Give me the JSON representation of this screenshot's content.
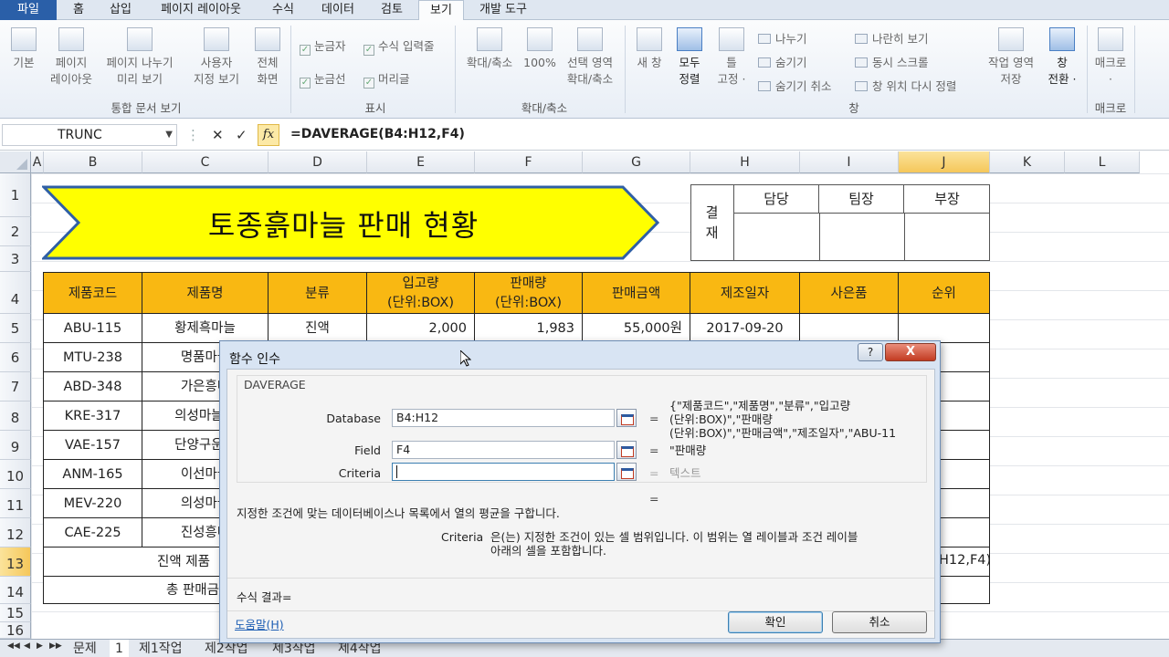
{
  "ribbon_tabs": [
    "파일",
    "홈",
    "삽입",
    "페이지 레이아웃",
    "수식",
    "데이터",
    "검토",
    "보기",
    "개발 도구"
  ],
  "ribbon": {
    "workbook_views": [
      "기본",
      "페이지 레이아웃",
      "페이지 나누기 미리 보기",
      "사용자 지정 보기",
      "전체 화면"
    ],
    "workbook_views_lines": [
      [
        "기본",
        ""
      ],
      [
        "페이지",
        "레이아웃"
      ],
      [
        "페이지 나누기",
        "미리 보기"
      ],
      [
        "사용자",
        "지정 보기"
      ],
      [
        "전체",
        "화면"
      ]
    ],
    "group_workbook_views": "통합 문서 보기",
    "show_items": [
      "눈금자",
      "수식 입력줄",
      "눈금선",
      "머리글"
    ],
    "group_show": "표시",
    "zoom_items": [
      [
        "확대/축소",
        ""
      ],
      [
        "100%",
        ""
      ],
      [
        "선택 영역",
        "확대/축소"
      ]
    ],
    "group_zoom": "확대/축소",
    "window_big": [
      [
        "새 창",
        ""
      ],
      [
        "모두",
        "정렬"
      ],
      [
        "틀",
        "고정 ·"
      ]
    ],
    "window_small_left": [
      "나누기",
      "숨기기",
      "숨기기 취소"
    ],
    "window_small_right": [
      "나란히 보기",
      "동시 스크롤",
      "창 위치 다시 정렬"
    ],
    "window_save": [
      "작업 영역",
      "저장"
    ],
    "window_switch": [
      "창",
      "전환 ·"
    ],
    "group_window": "창",
    "macro": "매크로",
    "macro_arrow": "·",
    "group_macro": "매크로"
  },
  "formula_bar": {
    "name_box": "TRUNC",
    "cancel": "✕",
    "enter": "✓",
    "fx": "fx",
    "formula": "=DAVERAGE(B4:H12,F4)"
  },
  "columns": [
    "A",
    "B",
    "C",
    "D",
    "E",
    "F",
    "G",
    "H",
    "I",
    "J",
    "K",
    "L"
  ],
  "rows": [
    "1",
    "2",
    "3",
    "4",
    "5",
    "6",
    "7",
    "8",
    "9",
    "10",
    "11",
    "12",
    "13",
    "14",
    "15",
    "16"
  ],
  "title": "토종흙마늘 판매 현황",
  "approval": {
    "label1": "결",
    "label2": "재",
    "cols": [
      "담당",
      "팀장",
      "부장"
    ]
  },
  "table": {
    "headers": [
      "제품코드",
      "제품명",
      "분류",
      "입고량",
      "(단위:BOX)",
      "판매량",
      "(단위:BOX)",
      "판매금액",
      "제조일자",
      "사은품",
      "순위"
    ],
    "rows": [
      [
        "ABU-115",
        "황제흑마늘",
        "진액",
        "2,000",
        "1,983",
        "55,000원",
        "2017-09-20"
      ],
      [
        "MTU-238",
        "명품마늘",
        "",
        "",
        "",
        "",
        ""
      ],
      [
        "ABD-348",
        "가은흥마",
        "",
        "",
        "",
        "",
        ""
      ],
      [
        "KRE-317",
        "의성마늘고",
        "",
        "",
        "",
        "",
        ""
      ],
      [
        "VAE-157",
        "단양구운마",
        "",
        "",
        "",
        "",
        ""
      ],
      [
        "ANM-165",
        "이선마늘",
        "",
        "",
        "",
        "",
        ""
      ],
      [
        "MEV-220",
        "의성마늘",
        "",
        "",
        "",
        "",
        ""
      ],
      [
        "CAE-225",
        "진성흥마",
        "",
        "",
        "",
        "",
        ""
      ]
    ],
    "row13_label": "진액 제품",
    "row13_tail": "H12,F4)",
    "row14_label": "총 판매금"
  },
  "sheet_tabs": [
    "문제",
    "1",
    "제1작업",
    "제2작업",
    "제3작업",
    "제4작업"
  ],
  "dialog": {
    "title": "함수 인수",
    "help_btn": "?",
    "close_btn": "X",
    "function": "DAVERAGE",
    "args": [
      {
        "label": "Database",
        "value": "B4:H12",
        "result_lines": [
          "{\"제품코드\",\"제품명\",\"분류\",\"입고량",
          "(단위:BOX)\",\"판매량",
          "(단위:BOX)\",\"판매금액\",\"제조일자\",\"ABU-11"
        ]
      },
      {
        "label": "Field",
        "value": "F4",
        "result_lines": [
          "\"판매량"
        ]
      },
      {
        "label": "Criteria",
        "value": "",
        "result_lines": [
          "텍스트"
        ]
      }
    ],
    "equals": "=",
    "result_equals": "=",
    "description": "지정한 조건에 맞는 데이터베이스나 목록에서 열의 평균을 구합니다.",
    "arg_desc_name": "Criteria",
    "arg_desc_lines": [
      "은(는) 지정한 조건이 있는 셀 범위입니다. 이 범위는 열 레이블과 조건 레이블",
      "아래의 셀을 포함합니다."
    ],
    "formula_result": "수식 결과=",
    "help_link": "도움말(H)",
    "ok": "확인",
    "cancel": "취소"
  },
  "colors": {
    "header_fill": "#f9b812",
    "banner_fill": "#ffff00",
    "banner_edge": "#2f5fa5",
    "selected_header": "#f5c75a"
  }
}
